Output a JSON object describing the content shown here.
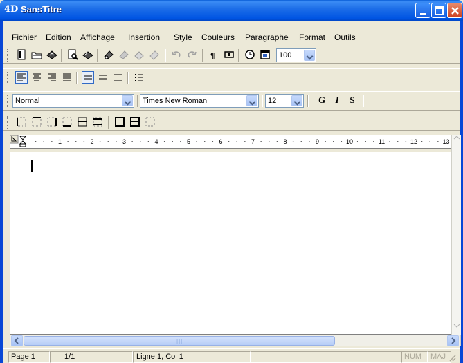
{
  "window": {
    "logo_text": "4D",
    "title": "SansTitre"
  },
  "menubar": {
    "items": [
      "Fichier",
      "Edition",
      "Affichage",
      "Insertion",
      "Style",
      "Couleurs",
      "Paragraphe",
      "Format",
      "Outils"
    ]
  },
  "toolbar1": {
    "zoom_value": "100"
  },
  "format_toolbar": {
    "style_value": "Normal",
    "font_value": "Times New Roman",
    "size_value": "12",
    "bold_label": "G",
    "italic_label": "I",
    "underline_label": "S"
  },
  "ruler": {
    "numbers": [
      "1",
      "2",
      "3",
      "4",
      "5",
      "6",
      "7",
      "8",
      "9",
      "10",
      "11",
      "12",
      "13"
    ]
  },
  "editor": {
    "content": ""
  },
  "statusbar": {
    "page": "Page 1",
    "pages": "1/1",
    "position": "Ligne 1, Col 1",
    "num": "NUM",
    "maj": "MAJ"
  },
  "icons": {
    "minimize": "minimize-icon",
    "maximize": "maximize-icon",
    "close": "close-icon",
    "new": "new-document-icon",
    "open": "open-folder-icon",
    "save": "save-icon",
    "print_preview": "print-preview-icon",
    "print": "print-icon",
    "cut": "cut-icon",
    "copy": "copy-icon",
    "paste": "paste-icon",
    "undo": "undo-icon",
    "redo": "redo-icon",
    "pilcrow": "show-formatting-icon",
    "table": "table-icon",
    "time": "clock-icon",
    "date": "calendar-icon"
  },
  "colors": {
    "title_bar": "#0054e3",
    "frame": "#ece9d8",
    "accent": "#316ac5"
  }
}
